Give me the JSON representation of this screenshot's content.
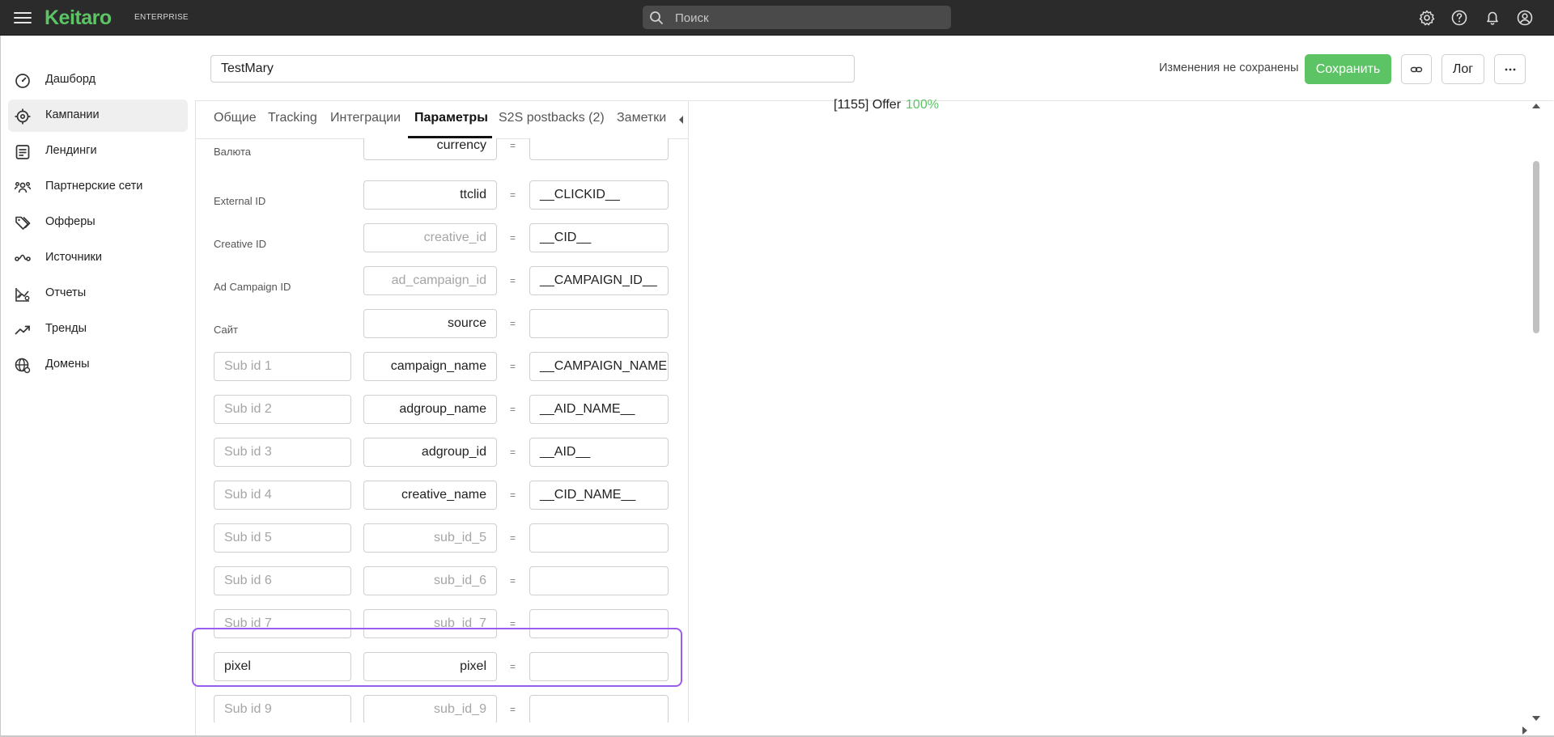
{
  "app": {
    "logo": "Keitaro",
    "edition": "ENTERPRISE"
  },
  "search": {
    "placeholder": "Поиск"
  },
  "sidebar": {
    "items": [
      {
        "label": "Дашборд",
        "icon": "gauge-icon"
      },
      {
        "label": "Кампании",
        "icon": "target-icon",
        "active": true
      },
      {
        "label": "Лендинги",
        "icon": "document-icon"
      },
      {
        "label": "Партнерские сети",
        "icon": "people-icon"
      },
      {
        "label": "Офферы",
        "icon": "tags-icon"
      },
      {
        "label": "Источники",
        "icon": "route-icon"
      },
      {
        "label": "Отчеты",
        "icon": "chart-icon",
        "has_submenu": true
      },
      {
        "label": "Тренды",
        "icon": "trend-icon"
      },
      {
        "label": "Домены",
        "icon": "globe-icon"
      }
    ]
  },
  "header": {
    "campaign_name": "TestMary",
    "unsaved_text": "Изменения не сохранены",
    "save_label": "Сохранить",
    "log_label": "Лог"
  },
  "tabs": [
    {
      "label": "Общие"
    },
    {
      "label": "Tracking"
    },
    {
      "label": "Интеграции"
    },
    {
      "label": "Параметры",
      "active": true
    },
    {
      "label": "S2S postbacks (2)"
    },
    {
      "label": "Заметки"
    }
  ],
  "params": {
    "equals": "=",
    "rows": [
      {
        "name": "Валюта",
        "key": "currency",
        "key_placeholder": false,
        "value": ""
      },
      {
        "name": "External ID",
        "key": "ttclid",
        "key_placeholder": false,
        "value": "__CLICKID__"
      },
      {
        "name": "Creative ID",
        "key": "creative_id",
        "key_placeholder": true,
        "value": "__CID__"
      },
      {
        "name": "Ad Campaign ID",
        "key": "ad_campaign_id",
        "key_placeholder": true,
        "value": "__CAMPAIGN_ID__"
      },
      {
        "name": "Сайт",
        "key": "source",
        "key_placeholder": false,
        "value": ""
      },
      {
        "name": "Sub id 1",
        "name_placeholder": true,
        "key": "campaign_name",
        "key_placeholder": false,
        "value": "__CAMPAIGN_NAME"
      },
      {
        "name": "Sub id 2",
        "name_placeholder": true,
        "key": "adgroup_name",
        "key_placeholder": false,
        "value": "__AID_NAME__"
      },
      {
        "name": "Sub id 3",
        "name_placeholder": true,
        "key": "adgroup_id",
        "key_placeholder": false,
        "value": "__AID__"
      },
      {
        "name": "Sub id 4",
        "name_placeholder": true,
        "key": "creative_name",
        "key_placeholder": false,
        "value": "__CID_NAME__"
      },
      {
        "name": "Sub id 5",
        "name_placeholder": true,
        "key": "sub_id_5",
        "key_placeholder": true,
        "value": ""
      },
      {
        "name": "Sub id 6",
        "name_placeholder": true,
        "key": "sub_id_6",
        "key_placeholder": true,
        "value": ""
      },
      {
        "name": "Sub id 7",
        "name_placeholder": true,
        "key": "sub_id_7",
        "key_placeholder": true,
        "value": ""
      },
      {
        "name": "pixel",
        "name_placeholder": false,
        "key": "pixel",
        "key_placeholder": false,
        "value": "",
        "highlighted": true
      },
      {
        "name": "Sub id 9",
        "name_placeholder": true,
        "key": "sub_id_9",
        "key_placeholder": true,
        "value": ""
      }
    ]
  },
  "preview": {
    "offer": "[1155] Offer",
    "percent": "100%"
  },
  "colors": {
    "accent": "#5cc464",
    "highlight": "#9b5cf0",
    "topbar": "#2b2b2b"
  }
}
